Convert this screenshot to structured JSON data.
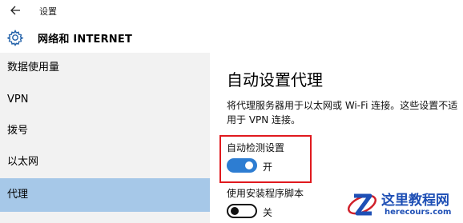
{
  "titlebar": {
    "title": "设置"
  },
  "header": {
    "title": "网络和 INTERNET"
  },
  "sidebar": {
    "items": [
      {
        "label": "数据使用量"
      },
      {
        "label": "VPN"
      },
      {
        "label": "拨号"
      },
      {
        "label": "以太网"
      },
      {
        "label": "代理",
        "active": true
      }
    ]
  },
  "main": {
    "section_title": "自动设置代理",
    "description": "将代理服务器用于以太网或 Wi-Fi 连接。这些设置不适用于 VPN 连接。",
    "settings": [
      {
        "label": "自动检测设置",
        "state_text": "开",
        "on": true
      },
      {
        "label": "使用安装程序脚本",
        "state_text": "关",
        "on": false
      }
    ]
  },
  "watermark": {
    "title": "这里教程网",
    "url": "herecours.com"
  },
  "colors": {
    "accent": "#2d7dd2",
    "selected": "#a6c8e8",
    "highlight": "#e0191e",
    "sidebar_bg": "#f2f2f2"
  }
}
